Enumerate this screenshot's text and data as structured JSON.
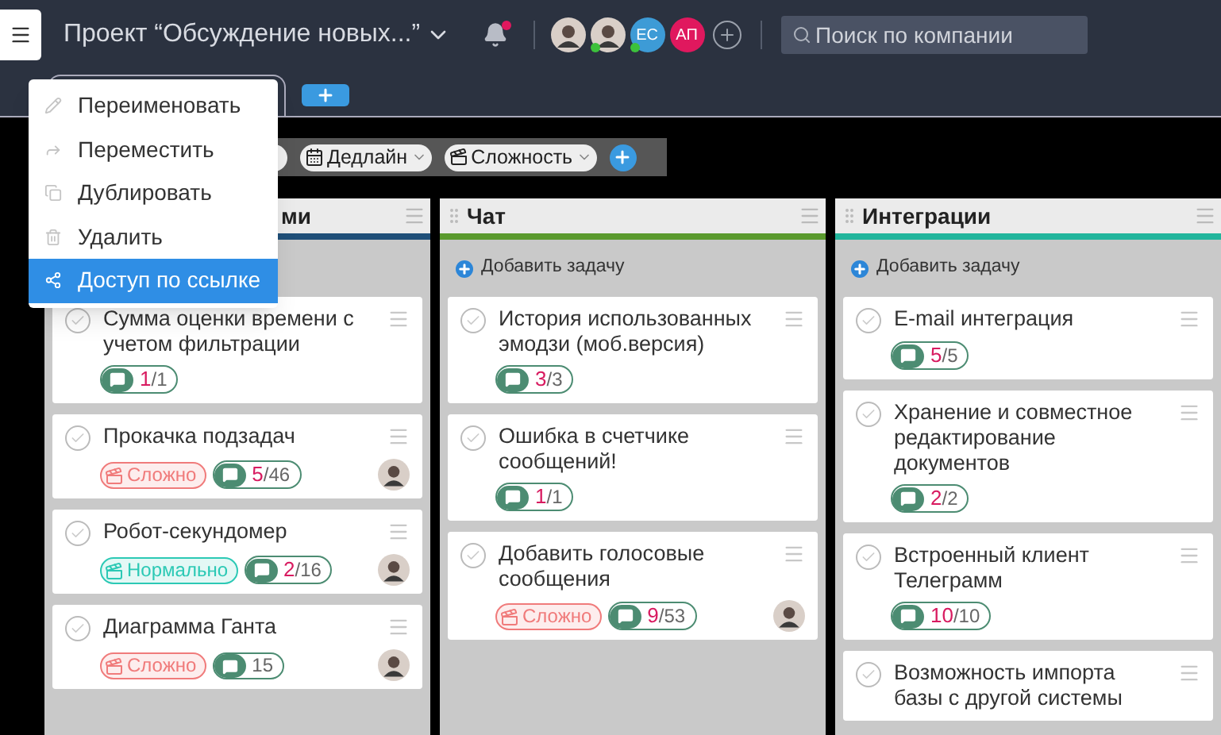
{
  "header": {
    "title": "Проект “Обсуждение новых...”",
    "unread": true,
    "members": [
      {
        "kind": "photo",
        "online": false
      },
      {
        "kind": "photo",
        "online": true
      },
      {
        "kind": "initials",
        "initials": "ЕС",
        "color": "#3d9bd6",
        "online": true
      },
      {
        "kind": "initials",
        "initials": "АП",
        "color": "#e0185e",
        "online": false
      }
    ],
    "search": {
      "placeholder": "Поиск по компании"
    }
  },
  "context_menu": {
    "items": [
      {
        "label": "Переименовать",
        "selected": false
      },
      {
        "label": "Переместить",
        "selected": false
      },
      {
        "label": "Дублировать",
        "selected": false
      },
      {
        "label": "Удалить",
        "selected": false
      },
      {
        "label": "Доступ по ссылке",
        "selected": true
      }
    ]
  },
  "filters": [
    {
      "label": "Дедлайн"
    },
    {
      "label": "Сложность"
    }
  ],
  "columns": [
    {
      "title": "ми",
      "color": "#1f4f78",
      "cards": [
        {
          "title": "Сумма оценки времени с учетом фильтрации",
          "done": false,
          "comments": {
            "done": "1",
            "total": "/1"
          },
          "avatar": false
        },
        {
          "title": "Прокачка подзадач",
          "done": false,
          "tags": [
            {
              "label": "Сложно",
              "color": "#f07b7b"
            }
          ],
          "comments": {
            "done": "5",
            "total": "/46"
          },
          "avatar": true
        },
        {
          "title": "Робот-секундомер",
          "done": false,
          "tags": [
            {
              "label": "Нормально",
              "color": "#2cc9b5"
            }
          ],
          "comments": {
            "done": "2",
            "total": "/16"
          },
          "avatar": true
        },
        {
          "title": "Диаграмма Ганта",
          "done": false,
          "tags": [
            {
              "label": "Сложно",
              "color": "#f07b7b"
            }
          ],
          "comments": {
            "total": "15"
          },
          "avatar": true
        }
      ]
    },
    {
      "title": "Чат",
      "color": "#5a9a2e",
      "add_task": "Добавить задачу",
      "cards": [
        {
          "title": "История использованных эмодзи (моб.версия)",
          "done": false,
          "comments": {
            "done": "3",
            "total": "/3"
          },
          "avatar": false
        },
        {
          "title": "Ошибка в счетчике сообщений!",
          "done": false,
          "comments": {
            "done": "1",
            "total": "/1"
          },
          "avatar": false
        },
        {
          "title": "Добавить голосовые сообщения",
          "done": false,
          "tags": [
            {
              "label": "Сложно",
              "color": "#f07b7b"
            }
          ],
          "comments": {
            "done": "9",
            "total": "/53"
          },
          "avatar": true
        }
      ]
    },
    {
      "title": "Интеграции",
      "color": "#22b59c",
      "add_task": "Добавить задачу",
      "cards": [
        {
          "title": "E-mail интеграция",
          "done": false,
          "comments": {
            "done": "5",
            "total": "/5"
          },
          "avatar": false
        },
        {
          "title": "Хранение и совместное редактирование документов",
          "done": false,
          "comments": {
            "done": "2",
            "total": "/2"
          },
          "avatar": false
        },
        {
          "title": "Встроенный клиент Телеграмм",
          "done": false,
          "comments": {
            "done": "10",
            "total": "/10"
          },
          "avatar": false
        },
        {
          "title": "Возможность импорта базы с другой системы",
          "done": false
        }
      ]
    }
  ]
}
